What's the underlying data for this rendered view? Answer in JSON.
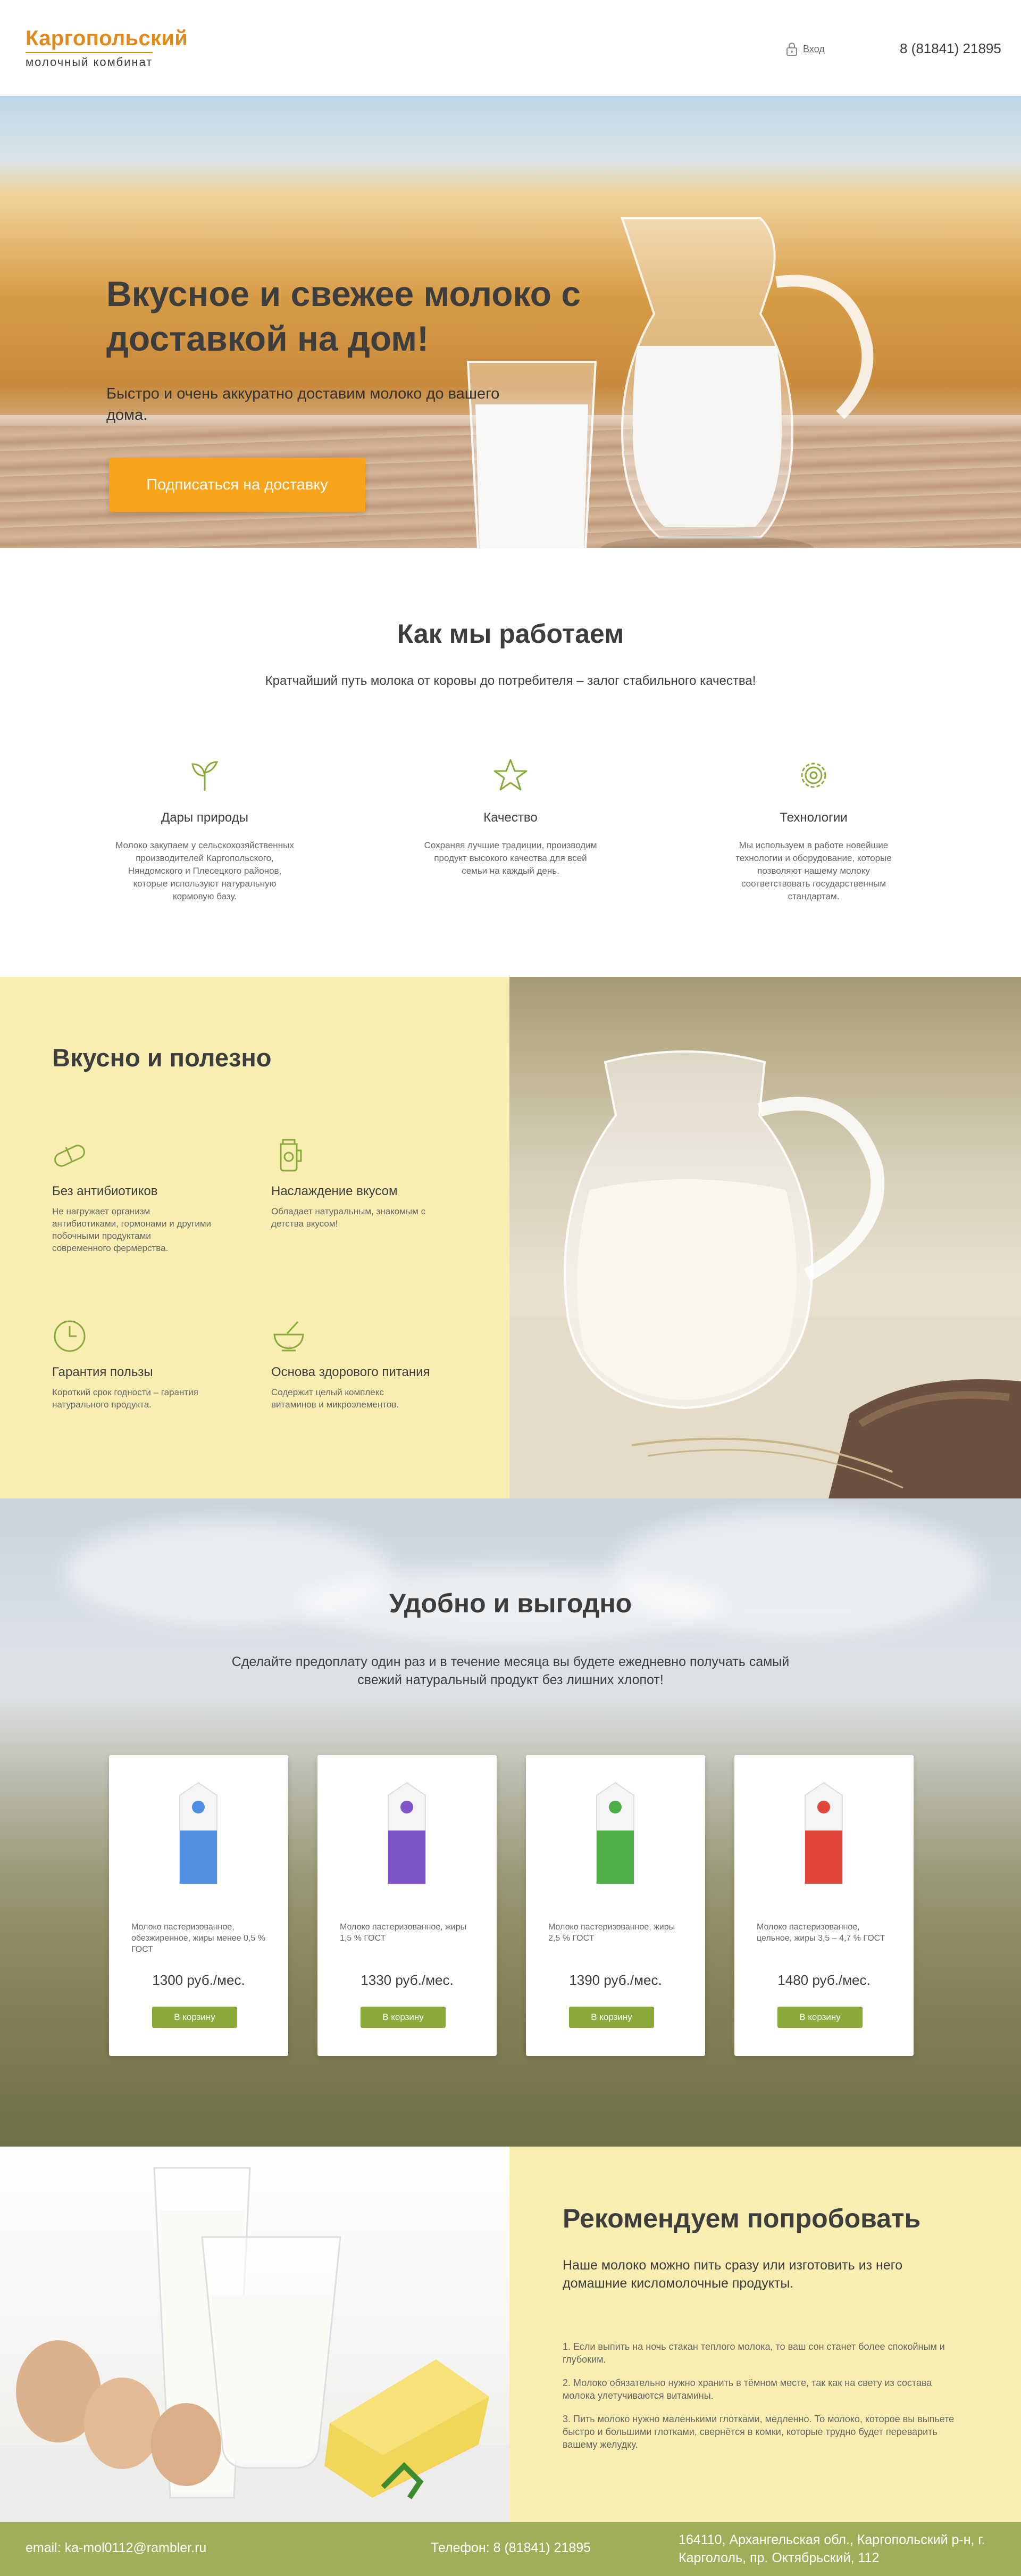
{
  "header": {
    "logo_top": "Каргопольский",
    "logo_bottom": "молочный комбинат",
    "login_label": "Вход",
    "phone": "8 (81841) 21895"
  },
  "hero": {
    "title": "Вкусное и свежее молоко с доставкой на дом!",
    "subtitle": "Быстро и очень аккуратно доставим молоко до вашего дома.",
    "cta_label": "Подписаться на доставку"
  },
  "how": {
    "title": "Как мы работаем",
    "lead": "Кратчайший путь молока от коровы до потребителя – залог стабильного качества!",
    "features": [
      {
        "icon": "sprout-icon",
        "title": "Дары природы",
        "desc": "Молоко закупаем у сельскохозяйственных производителей Каргопольского, Няндомского  и Плесецкого районов, которые используют натуральную кормовую базу."
      },
      {
        "icon": "star-icon",
        "title": "Качество",
        "desc": "Сохраняя лучшие традиции, производим продукт высокого качества для всей семьи на каждый день."
      },
      {
        "icon": "gear-icon",
        "title": "Технологии",
        "desc": "Мы используем  в работе новейшие технологии и оборудование, которые позволяют нашему молоку соответствовать государственным стандартам."
      }
    ]
  },
  "tasty": {
    "title": "Вкусно и полезно",
    "benefits": [
      {
        "icon": "pill-icon",
        "title": "Без антибиотиков",
        "desc": "Не нагружает организм антибиотиками, гормонами и другими побочными продуктами современного фермерства."
      },
      {
        "icon": "milk-can-icon",
        "title": "Наслаждение вкусом",
        "desc": "Обладает натуральным, знакомым  с детства вкусом!"
      },
      {
        "icon": "clock-icon",
        "title": "Гарантия пользы",
        "desc": "Короткий срок годности – гарантия натурального продукта."
      },
      {
        "icon": "bowl-icon",
        "title": "Основа здорового питания",
        "desc": "Содержит целый комплекс витаминов  и микроэлементов."
      }
    ]
  },
  "pricing": {
    "title": "Удобно и выгодно",
    "lead": "Сделайте предоплату один раз и в течение месяца вы будете ежедневно получать самый свежий натуральный продукт без лишних хлопот!",
    "products": [
      {
        "desc": "Молоко пастеризованное, обезжиренное, жиры менее 0,5 %  ГОСТ",
        "price": "1300 руб./мес.",
        "button": "В корзину",
        "color": "#4f8fe0"
      },
      {
        "desc": "Молоко пастеризованное, жиры 1,5 %  ГОСТ",
        "price": "1330 руб./мес.",
        "button": "В корзину",
        "color": "#7e56c9"
      },
      {
        "desc": "Молоко пастеризованное, жиры 2,5 %  ГОСТ",
        "price": "1390 руб./мес.",
        "button": "В корзину",
        "color": "#4cae45"
      },
      {
        "desc": "Молоко пастеризованное, цельное, жиры 3,5 – 4,7 %  ГОСТ",
        "price": "1480 руб./мес.",
        "button": "В корзину",
        "color": "#e0463c"
      }
    ]
  },
  "recommend": {
    "title": "Рекомендуем попробовать",
    "lead": "Наше молоко можно пить сразу или изготовить из него домашние кисломолочные продукты.",
    "tips": [
      "1. Если выпить на ночь стакан теплого молока, то ваш сон станет более спокойным и глубоким.",
      "2. Молоко обязательно нужно хранить в тёмном месте, так как на свету из состава молока улетучиваются витамины.",
      "3. Пить молоко нужно маленькими глотками, медленно. То молоко, которое вы выпьете быстро и большими глотками, свернётся в комки, которые трудно будет переварить вашему желудку."
    ]
  },
  "footer": {
    "email": "email: ka-mol0112@rambler.ru",
    "phone": "Телефон: 8 (81841) 21895",
    "address": "164110, Архангельская обл., Каргопольский р-н, г. Каргололь, пр. Октябрьский, 112"
  },
  "colors": {
    "brand_orange": "#e08a1c",
    "cta_orange": "#f9a21b",
    "cream": "#f9eeb1",
    "green_button": "#8aab3c",
    "footer_green": "#9fae59",
    "text_dark": "#3d3d3d"
  }
}
